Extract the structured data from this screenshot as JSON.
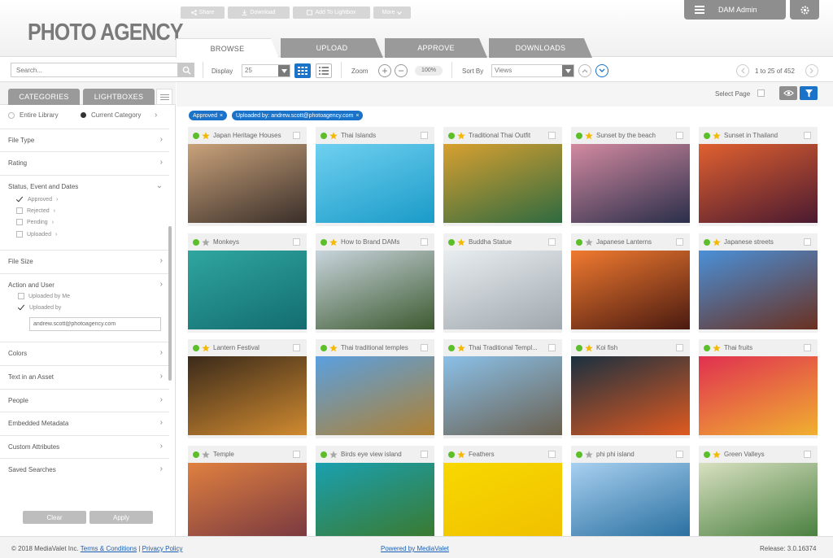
{
  "header": {
    "logo": "PHOTO AGENCY",
    "admin_label": "DAM Admin",
    "tabs": [
      {
        "label": "BROWSE",
        "active": true
      },
      {
        "label": "UPLOAD",
        "active": false
      },
      {
        "label": "APPROVE",
        "active": false
      },
      {
        "label": "DOWNLOADS",
        "active": false
      }
    ]
  },
  "toolbar": {
    "search_placeholder": "Search...",
    "display_label": "Display",
    "display_value": "25",
    "zoom_label": "Zoom",
    "zoom_value": "100%",
    "sort_label": "Sort By",
    "sort_value": "Views",
    "pager_text": "1 to 25 of 452"
  },
  "sidebar": {
    "tabs": [
      "CATEGORIES",
      "LIGHTBOXES"
    ],
    "scope": {
      "entire": "Entire Library",
      "current": "Current Category"
    },
    "sections": {
      "file_type": "File Type",
      "rating": "Rating",
      "status": "Status, Event and Dates",
      "file_size": "File Size",
      "action_user": "Action and User",
      "colors": "Colors",
      "text_asset": "Text in an Asset",
      "people": "People",
      "embedded": "Embedded Metadata",
      "custom": "Custom Attributes",
      "saved": "Saved Searches"
    },
    "status_items": [
      {
        "label": "Approved",
        "checked": true
      },
      {
        "label": "Rejected",
        "checked": false
      },
      {
        "label": "Pending",
        "checked": false
      },
      {
        "label": "Uploaded",
        "checked": false
      }
    ],
    "user_items": [
      {
        "label": "Uploaded by Me",
        "checked": false
      },
      {
        "label": "Uploaded by",
        "checked": true
      }
    ],
    "uploaded_by_value": "andrew.scott@photoagency.com",
    "clear_label": "Clear",
    "apply_label": "Apply"
  },
  "actions": {
    "share": "Share",
    "download": "Download",
    "add_lightbox": "Add To Lightbox",
    "more": "More",
    "select_page": "Select Page"
  },
  "chips": [
    {
      "label": "Approved"
    },
    {
      "label": "Uploaded by: andrew.scott@photoagency.com"
    }
  ],
  "assets": [
    {
      "title": "Japan Heritage Houses",
      "star": "gold",
      "c1": "#c9a27a",
      "c2": "#3a2f2a"
    },
    {
      "title": "Thai Islands",
      "star": "gold",
      "c1": "#6fd0f0",
      "c2": "#1a9bc8"
    },
    {
      "title": "Traditional Thai Outfit",
      "star": "gold",
      "c1": "#d8a030",
      "c2": "#2e6a40"
    },
    {
      "title": "Sunset by the beach",
      "star": "gold",
      "c1": "#d28aa0",
      "c2": "#2a2e4a"
    },
    {
      "title": "Sunset in Thailand",
      "star": "gold",
      "c1": "#e06030",
      "c2": "#4a1a30"
    },
    {
      "title": "Monkeys",
      "star": "grey",
      "c1": "#2fa6a0",
      "c2": "#136c70"
    },
    {
      "title": "How to Brand DAMs",
      "star": "gold",
      "c1": "#c8d4dc",
      "c2": "#3d5a30"
    },
    {
      "title": "Buddha Statue",
      "star": "gold",
      "c1": "#e8edf0",
      "c2": "#a0a8ae"
    },
    {
      "title": "Japanese Lanterns",
      "star": "grey",
      "c1": "#f07a30",
      "c2": "#4a1a10"
    },
    {
      "title": "Japanese streets",
      "star": "gold",
      "c1": "#4a90d8",
      "c2": "#6a3020"
    },
    {
      "title": "Lantern Festival",
      "star": "gold",
      "c1": "#3a2a1a",
      "c2": "#d08a30"
    },
    {
      "title": "Thai traditional temples",
      "star": "gold",
      "c1": "#5aa0e0",
      "c2": "#b08030"
    },
    {
      "title": "Thai Traditional Templ...",
      "star": "gold",
      "c1": "#8ac0e8",
      "c2": "#6a6050"
    },
    {
      "title": "Koi fish",
      "star": "gold",
      "c1": "#1a3040",
      "c2": "#e05a20"
    },
    {
      "title": "Thai fruits",
      "star": "gold",
      "c1": "#e03050",
      "c2": "#f0b030"
    },
    {
      "title": "Temple",
      "star": "grey",
      "c1": "#e08040",
      "c2": "#7a3a40"
    },
    {
      "title": "Birds eye view island",
      "star": "grey",
      "c1": "#1aa0b0",
      "c2": "#3a7a30"
    },
    {
      "title": "Feathers",
      "star": "gold",
      "c1": "#f8d800",
      "c2": "#f0c000"
    },
    {
      "title": "phi phi island",
      "star": "grey",
      "c1": "#a8d0f0",
      "c2": "#2a70a0"
    },
    {
      "title": "Green Valleys",
      "star": "gold",
      "c1": "#d8e0c0",
      "c2": "#4a8040"
    }
  ],
  "footer": {
    "copyright": "© 2018 MediaValet Inc.",
    "terms": "Terms & Conditions",
    "sep": "|",
    "privacy": "Privacy Policy",
    "powered": "Powered by MediaValet",
    "release": "Release: 3.0.16374"
  },
  "colors": {
    "accent": "#1a73c8",
    "status_green": "#5cbf2a",
    "star_gold": "#f5b800",
    "tab_grey": "#9a9a9a"
  }
}
